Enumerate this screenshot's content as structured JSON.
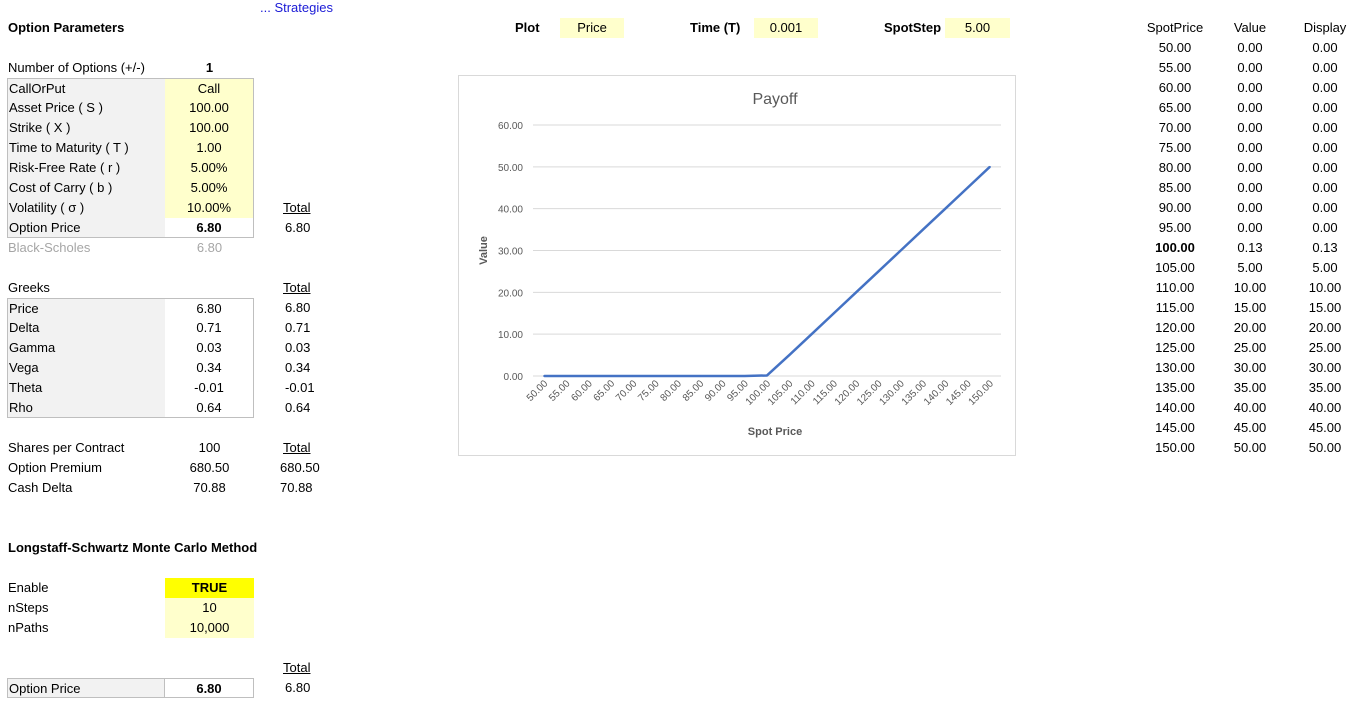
{
  "strategies_link": "... Strategies",
  "params": {
    "title": "Option Parameters",
    "num_options_label": "Number of Options (+/-)",
    "num_options_value": "1",
    "rows": [
      {
        "label": "CallOrPut",
        "value": "Call"
      },
      {
        "label": "Asset Price ( S )",
        "value": "100.00"
      },
      {
        "label": "Strike ( X )",
        "value": "100.00"
      },
      {
        "label": "Time to Maturity ( T )",
        "value": "1.00"
      },
      {
        "label": "Risk-Free Rate ( r )",
        "value": "5.00%"
      },
      {
        "label": "Cost of Carry ( b )",
        "value": "5.00%"
      },
      {
        "label": "Volatility ( σ )",
        "value": "10.00%"
      }
    ],
    "total_header": "Total",
    "option_price_label": "Option Price",
    "option_price_value": "6.80",
    "option_price_total": "6.80",
    "black_scholes_label": "Black-Scholes",
    "black_scholes_value": "6.80"
  },
  "greeks": {
    "title": "Greeks",
    "total_header": "Total",
    "rows": [
      {
        "label": "Price",
        "value": "6.80",
        "total": "6.80"
      },
      {
        "label": "Delta",
        "value": "0.71",
        "total": "0.71"
      },
      {
        "label": "Gamma",
        "value": "0.03",
        "total": "0.03"
      },
      {
        "label": "Vega",
        "value": "0.34",
        "total": "0.34"
      },
      {
        "label": "Theta",
        "value": "-0.01",
        "total": "-0.01"
      },
      {
        "label": "Rho",
        "value": "0.64",
        "total": "0.64"
      }
    ]
  },
  "contract": {
    "total_header": "Total",
    "rows": [
      {
        "label": "Shares per Contract",
        "value": "100",
        "total": ""
      },
      {
        "label": "Option Premium",
        "value": "680.50",
        "total": "680.50"
      },
      {
        "label": "Cash Delta",
        "value": "70.88",
        "total": "70.88"
      }
    ]
  },
  "lsmc": {
    "title": "Longstaff-Schwartz Monte Carlo Method",
    "rows": [
      {
        "label": "Enable",
        "value": "TRUE"
      },
      {
        "label": "nSteps",
        "value": "10"
      },
      {
        "label": "nPaths",
        "value": "10,000"
      }
    ],
    "total_header": "Total",
    "option_price_label": "Option Price",
    "option_price_value": "6.80",
    "option_price_total": "6.80"
  },
  "plot_controls": {
    "plot_label": "Plot",
    "plot_value": "Price",
    "time_label": "Time (T)",
    "time_value": "0.001",
    "spotstep_label": "SpotStep",
    "spotstep_value": "5.00"
  },
  "table": {
    "headers": [
      "SpotPrice",
      "Value",
      "Display"
    ],
    "rows": [
      [
        "50.00",
        "0.00",
        "0.00"
      ],
      [
        "55.00",
        "0.00",
        "0.00"
      ],
      [
        "60.00",
        "0.00",
        "0.00"
      ],
      [
        "65.00",
        "0.00",
        "0.00"
      ],
      [
        "70.00",
        "0.00",
        "0.00"
      ],
      [
        "75.00",
        "0.00",
        "0.00"
      ],
      [
        "80.00",
        "0.00",
        "0.00"
      ],
      [
        "85.00",
        "0.00",
        "0.00"
      ],
      [
        "90.00",
        "0.00",
        "0.00"
      ],
      [
        "95.00",
        "0.00",
        "0.00"
      ],
      [
        "100.00",
        "0.13",
        "0.13"
      ],
      [
        "105.00",
        "5.00",
        "5.00"
      ],
      [
        "110.00",
        "10.00",
        "10.00"
      ],
      [
        "115.00",
        "15.00",
        "15.00"
      ],
      [
        "120.00",
        "20.00",
        "20.00"
      ],
      [
        "125.00",
        "25.00",
        "25.00"
      ],
      [
        "130.00",
        "30.00",
        "30.00"
      ],
      [
        "135.00",
        "35.00",
        "35.00"
      ],
      [
        "140.00",
        "40.00",
        "40.00"
      ],
      [
        "145.00",
        "45.00",
        "45.00"
      ],
      [
        "150.00",
        "50.00",
        "50.00"
      ]
    ],
    "bold_row": 10
  },
  "chart_data": {
    "type": "line",
    "title": "Payoff",
    "xlabel": "Spot Price",
    "ylabel": "Value",
    "ylim": [
      0,
      60
    ],
    "yticks": [
      "0.00",
      "10.00",
      "20.00",
      "30.00",
      "40.00",
      "50.00",
      "60.00"
    ],
    "categories": [
      "50.00",
      "55.00",
      "60.00",
      "65.00",
      "70.00",
      "75.00",
      "80.00",
      "85.00",
      "90.00",
      "95.00",
      "100.00",
      "105.00",
      "110.00",
      "115.00",
      "120.00",
      "125.00",
      "130.00",
      "135.00",
      "140.00",
      "145.00",
      "150.00"
    ],
    "values": [
      0,
      0,
      0,
      0,
      0,
      0,
      0,
      0,
      0,
      0,
      0.13,
      5,
      10,
      15,
      20,
      25,
      30,
      35,
      40,
      45,
      50
    ],
    "line_color": "#4472c4",
    "grid": true
  }
}
